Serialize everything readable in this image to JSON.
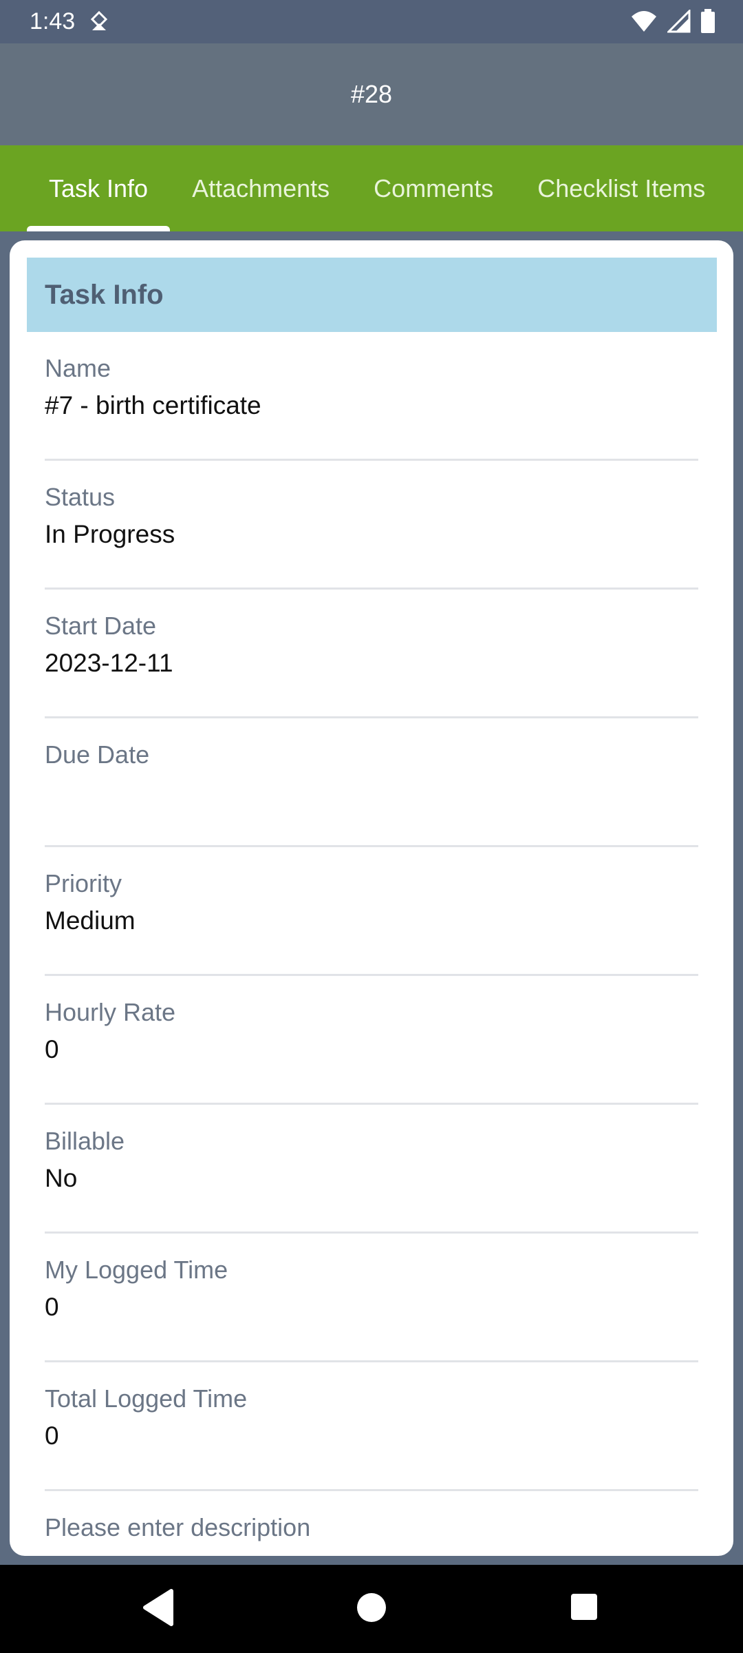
{
  "status_bar": {
    "time": "1:43"
  },
  "app_bar": {
    "title": "#28"
  },
  "tabs": [
    {
      "label": "Task Info"
    },
    {
      "label": "Attachments"
    },
    {
      "label": "Comments"
    },
    {
      "label": "Checklist Items"
    }
  ],
  "section": {
    "title": "Task Info"
  },
  "fields": [
    {
      "label": "Name",
      "value": "#7 - birth certificate"
    },
    {
      "label": "Status",
      "value": "In Progress"
    },
    {
      "label": "Start Date",
      "value": "2023-12-11"
    },
    {
      "label": "Due Date",
      "value": ""
    },
    {
      "label": "Priority",
      "value": "Medium"
    },
    {
      "label": "Hourly Rate",
      "value": "0"
    },
    {
      "label": "Billable",
      "value": "No"
    },
    {
      "label": "My Logged Time",
      "value": "0"
    },
    {
      "label": "Total Logged Time",
      "value": "0"
    },
    {
      "label": "Please enter description",
      "value": ""
    }
  ],
  "colors": {
    "status_bar": "#536179",
    "app_bar": "#64717f",
    "tab_bar": "#6ba422",
    "section_header": "#add9ea"
  }
}
